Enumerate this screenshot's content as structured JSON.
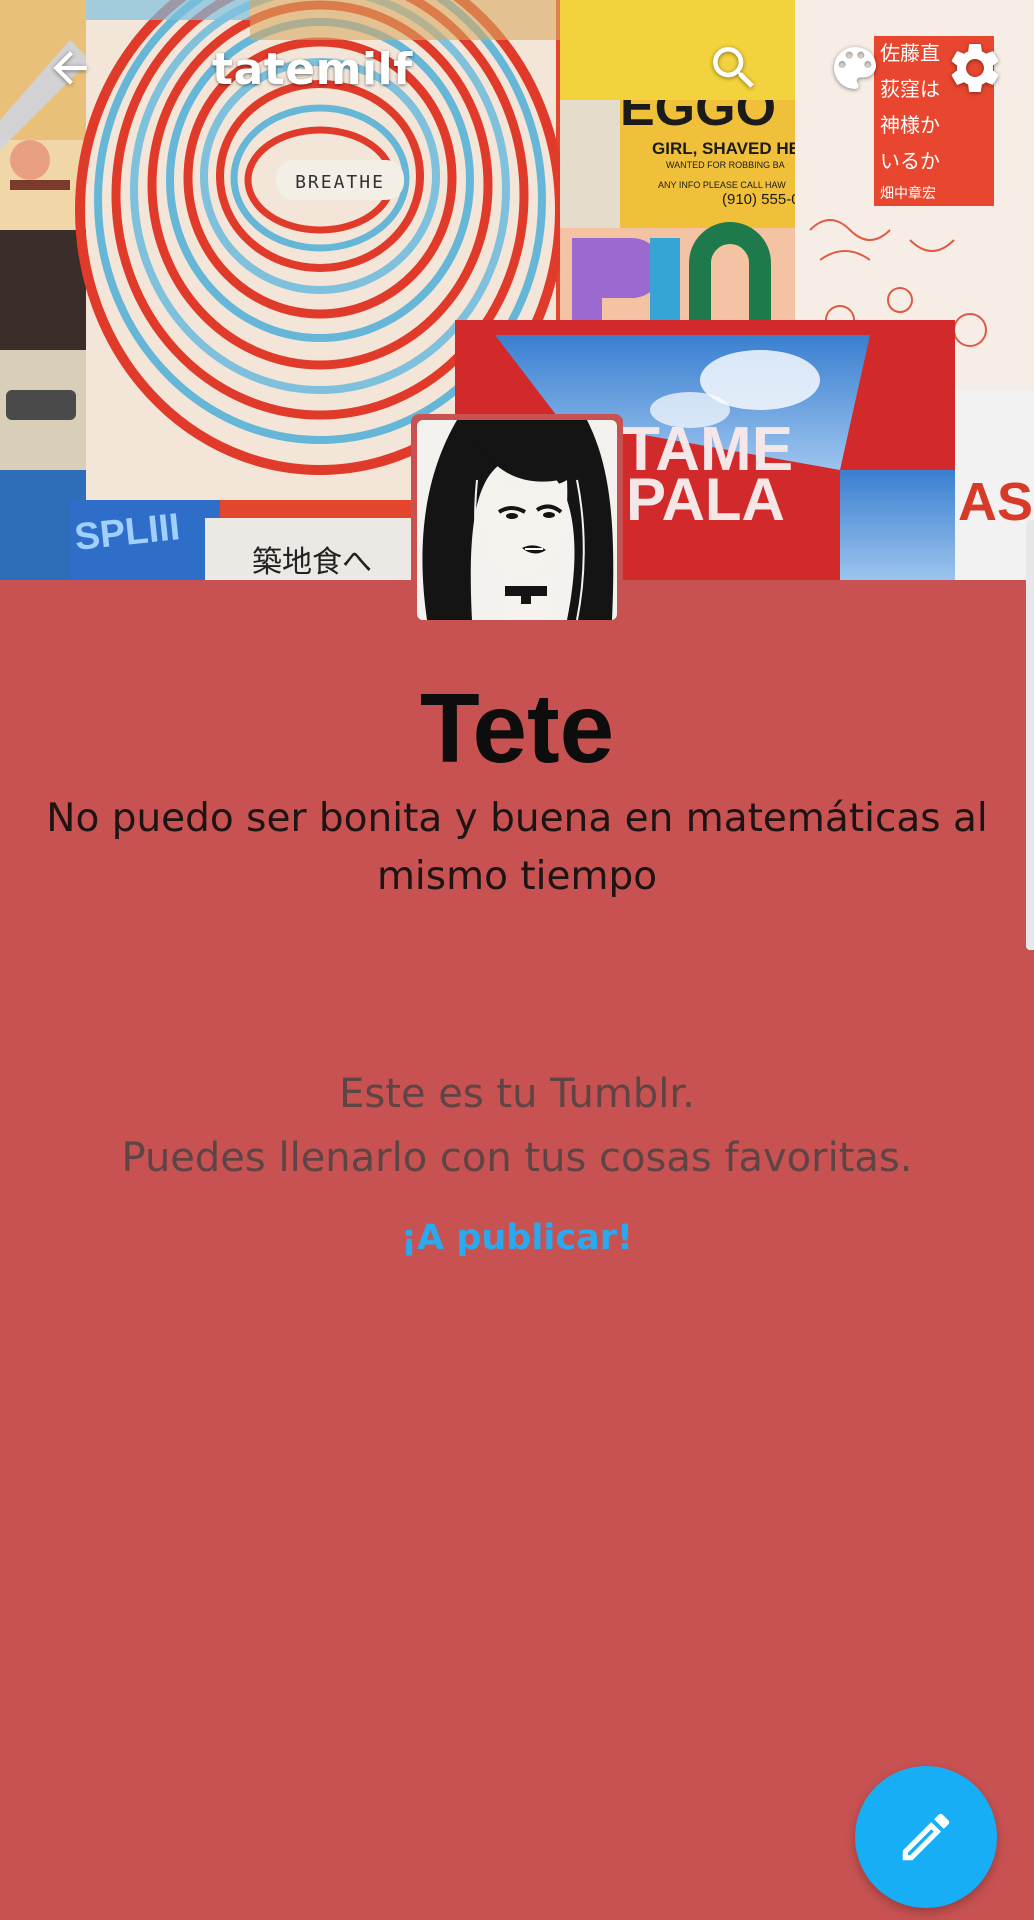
{
  "header": {
    "blog_name": "tatemilf",
    "icons": {
      "back": "arrow-left-icon",
      "search": "search-icon",
      "palette": "palette-icon",
      "settings": "gear-icon"
    }
  },
  "header_image": {
    "texts": {
      "breathe": "BREATHE",
      "eggo": "EGGO",
      "wanted_title": "GIRL, SHAVED HEA",
      "wanted_sub": "WANTED FOR ROBBING BA",
      "wanted_info": "ANY INFO PLEASE CALL HAW",
      "wanted_phone": "(910) 555-0",
      "tame": "TAME",
      "impala": "PALA",
      "sign_jp": "築地食へ",
      "jp_col_1": "佐藤直",
      "jp_col_2": "荻窪は",
      "jp_col_3": "神様か",
      "jp_col_4": "いるか",
      "jp_col_5": "畑中章宏",
      "as": "AS",
      "splash": "SPLIII"
    }
  },
  "profile": {
    "title": "Tete",
    "description": "No puedo ser bonita y buena en matemáticas al mismo tiempo"
  },
  "empty_state": {
    "line1": "Este es tu Tumblr.",
    "line2": "Puedes llenarlo con tus cosas favoritas.",
    "cta": "¡A publicar!"
  },
  "fab": {
    "icon": "pencil-icon"
  },
  "colors": {
    "background": "#c85252",
    "accent": "#18aef5",
    "link": "#2aa9ee",
    "title_text": "#0d0d0d"
  }
}
